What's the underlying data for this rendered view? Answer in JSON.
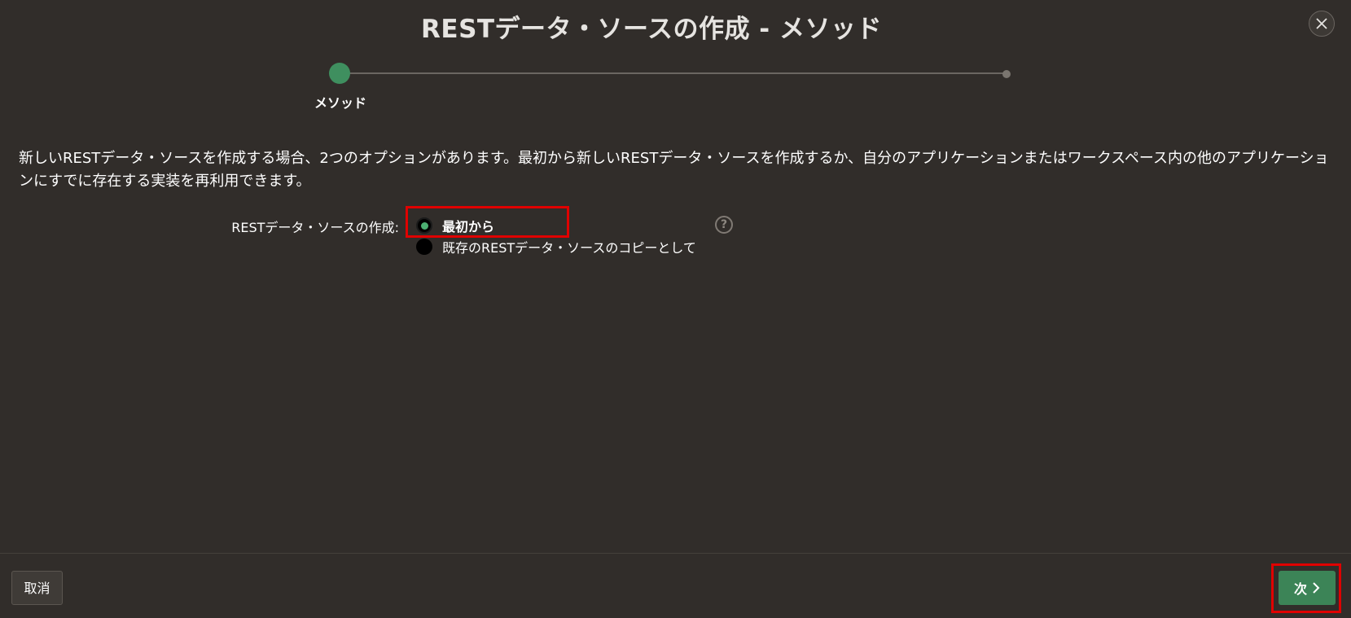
{
  "dialog": {
    "title": "RESTデータ・ソースの作成 - メソッド"
  },
  "progress": {
    "steps": [
      {
        "label": "メソッド",
        "state": "current"
      },
      {
        "label": "",
        "state": "upcoming"
      }
    ],
    "current_color": "#3f8f5f"
  },
  "content": {
    "description": "新しいRESTデータ・ソースを作成する場合、2つのオプションがあります。最初から新しいRESTデータ・ソースを作成するか、自分のアプリケーションまたはワークスペース内の他のアプリケーションにすでに存在する実装を再利用できます。",
    "field_label": "RESTデータ・ソースの作成:",
    "options": [
      {
        "label": "最初から",
        "selected": true
      },
      {
        "label": "既存のRESTデータ・ソースのコピーとして",
        "selected": false
      }
    ],
    "help_glyph": "?"
  },
  "footer": {
    "cancel_label": "取消",
    "next_label": "次"
  },
  "colors": {
    "background": "#312d2a",
    "primary_button": "#3c8457",
    "highlight": "#e00000"
  },
  "icons": {
    "close": "close-icon",
    "help": "help-icon",
    "next": "chevron-right-icon"
  }
}
